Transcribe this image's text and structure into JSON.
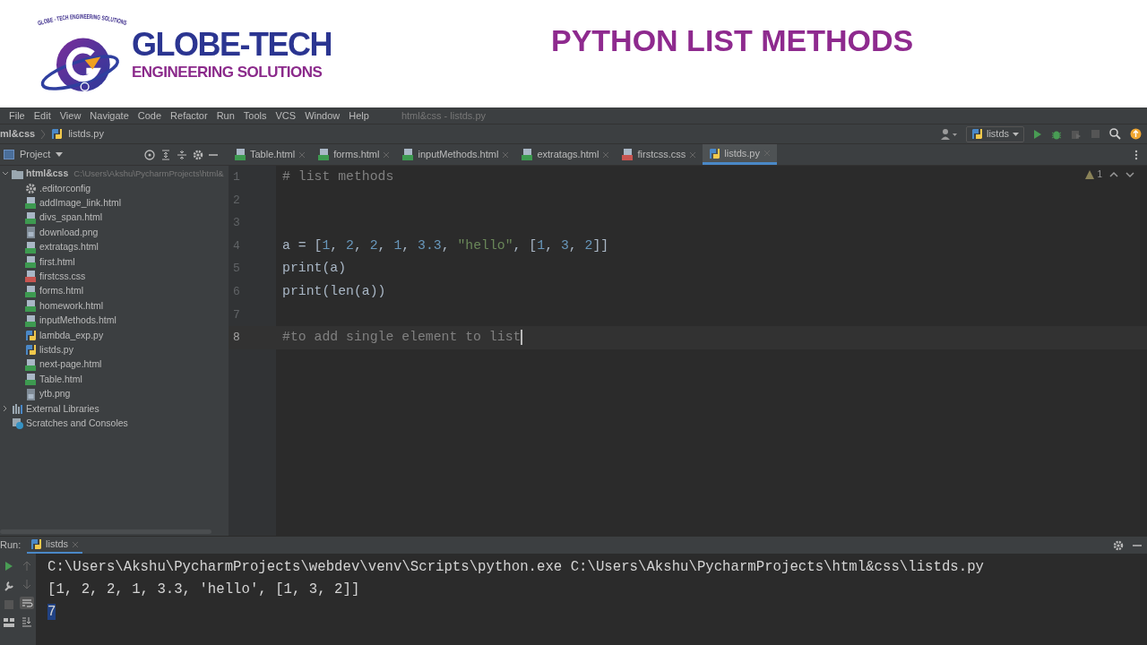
{
  "header": {
    "logo": {
      "ring_text": "GLOBE - TECH  ENGINEERING  SOLUTIONS",
      "name": "GLOBE-TECH",
      "tagline": "ENGINEERING SOLUTIONS"
    },
    "title": "PYTHON LIST METHODS"
  },
  "menu_bar": {
    "items": [
      "File",
      "Edit",
      "View",
      "Navigate",
      "Code",
      "Refactor",
      "Run",
      "Tools",
      "VCS",
      "Window",
      "Help"
    ],
    "window_title": "html&css - listds.py"
  },
  "breadcrumb": [
    "ml&css",
    "listds.py"
  ],
  "run_config": "listds",
  "project_panel": {
    "title": "Project",
    "tree": [
      {
        "label": "html&css",
        "path": "C:\\Users\\Akshu\\PycharmProjects\\html&",
        "kind": "folder",
        "expanded": true,
        "children": [
          {
            "label": ".editorconfig",
            "kind": "config"
          },
          {
            "label": "addImage_link.html",
            "kind": "html"
          },
          {
            "label": "divs_span.html",
            "kind": "html"
          },
          {
            "label": "download.png",
            "kind": "image"
          },
          {
            "label": "extratags.html",
            "kind": "html"
          },
          {
            "label": "first.html",
            "kind": "html"
          },
          {
            "label": "firstcss.css",
            "kind": "css"
          },
          {
            "label": "forms.html",
            "kind": "html"
          },
          {
            "label": "homework.html",
            "kind": "html"
          },
          {
            "label": "inputMethods.html",
            "kind": "html"
          },
          {
            "label": "lambda_exp.py",
            "kind": "python"
          },
          {
            "label": "listds.py",
            "kind": "python"
          },
          {
            "label": "next-page.html",
            "kind": "html"
          },
          {
            "label": "Table.html",
            "kind": "html"
          },
          {
            "label": "ytb.png",
            "kind": "image"
          }
        ]
      },
      {
        "label": "External Libraries",
        "kind": "library",
        "expanded": false
      },
      {
        "label": "Scratches and Consoles",
        "kind": "scratch"
      }
    ]
  },
  "editor_tabs": [
    {
      "label": "Table.html",
      "kind": "html",
      "selected": false
    },
    {
      "label": "forms.html",
      "kind": "html",
      "selected": false
    },
    {
      "label": "inputMethods.html",
      "kind": "html",
      "selected": false
    },
    {
      "label": "extratags.html",
      "kind": "html",
      "selected": false
    },
    {
      "label": "firstcss.css",
      "kind": "css",
      "selected": false
    },
    {
      "label": "listds.py",
      "kind": "python",
      "selected": true
    }
  ],
  "editor": {
    "warning_count": "1",
    "lines": [
      {
        "number": "1",
        "current": false,
        "tokens": [
          {
            "kind": "comment",
            "text": "# list methods"
          }
        ]
      },
      {
        "number": "2",
        "current": false
      },
      {
        "number": "3",
        "current": false
      },
      {
        "number": "4",
        "current": false,
        "tokens": [
          {
            "kind": "plain",
            "text": "a = ["
          },
          {
            "kind": "number",
            "text": "1"
          },
          {
            "kind": "plain",
            "text": ", "
          },
          {
            "kind": "number",
            "text": "2"
          },
          {
            "kind": "plain",
            "text": ", "
          },
          {
            "kind": "number",
            "text": "2"
          },
          {
            "kind": "plain",
            "text": ", "
          },
          {
            "kind": "number",
            "text": "1"
          },
          {
            "kind": "plain",
            "text": ", "
          },
          {
            "kind": "number",
            "text": "3.3"
          },
          {
            "kind": "plain",
            "text": ", "
          },
          {
            "kind": "string",
            "text": "\"hello\""
          },
          {
            "kind": "plain",
            "text": ", ["
          },
          {
            "kind": "number",
            "text": "1"
          },
          {
            "kind": "plain",
            "text": ", "
          },
          {
            "kind": "number",
            "text": "3"
          },
          {
            "kind": "plain",
            "text": ", "
          },
          {
            "kind": "number",
            "text": "2"
          },
          {
            "kind": "plain",
            "text": "]]"
          }
        ]
      },
      {
        "number": "5",
        "current": false,
        "tokens": [
          {
            "kind": "plain",
            "text": "print(a)"
          }
        ]
      },
      {
        "number": "6",
        "current": false,
        "tokens": [
          {
            "kind": "plain",
            "text": "print(len(a))"
          }
        ]
      },
      {
        "number": "7",
        "current": false
      },
      {
        "number": "8",
        "current": true,
        "tokens": [
          {
            "kind": "comment",
            "text": "#to add single element to list"
          }
        ]
      }
    ]
  },
  "run_panel": {
    "label": "Run:",
    "tab": "listds",
    "output": [
      {
        "text": "C:\\Users\\Akshu\\PycharmProjects\\webdev\\venv\\Scripts\\python.exe C:\\Users\\Akshu\\PycharmProjects\\html&css\\listds.py",
        "selected": false
      },
      {
        "text": "[1, 2, 2, 1, 3.3, 'hello', [1, 3, 2]]",
        "selected": false
      },
      {
        "text": "7",
        "selected": true
      }
    ]
  }
}
